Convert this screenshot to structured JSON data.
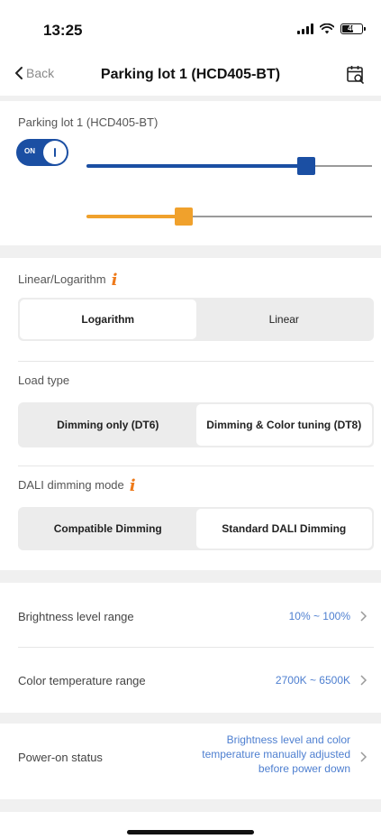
{
  "status_bar": {
    "time": "13:25",
    "battery": "40",
    "icons": [
      "signal-icon",
      "wifi-icon",
      "battery-icon"
    ]
  },
  "nav": {
    "back_label": "Back",
    "title": "Parking lot 1 (HCD405-BT)",
    "action_icon": "calendar-search-icon"
  },
  "device": {
    "name": "Parking lot 1 (HCD405-BT)",
    "power_toggle": {
      "label": "ON",
      "state": true
    },
    "brightness_level": 0.77,
    "color_temperature_level": 0.34,
    "colors": {
      "brightness": "#1b4fa3",
      "color_temperature": "#f0a12c",
      "track": "#9a9a9a"
    }
  },
  "linear_logarithm": {
    "label": "Linear/Logarithm",
    "options": [
      "Logarithm",
      "Linear"
    ],
    "selected": "Logarithm"
  },
  "load_type": {
    "label": "Load type",
    "options": [
      "Dimming only (DT6)",
      "Dimming & Color tuning (DT8)"
    ],
    "selected": "Dimming & Color tuning (DT8)"
  },
  "dali_mode": {
    "label": "DALI dimming mode",
    "options": [
      "Compatible Dimming",
      "Standard DALI Dimming"
    ],
    "selected": "Standard DALI Dimming"
  },
  "settings": {
    "brightness_range": {
      "label": "Brightness level range",
      "value": "10% ~ 100%"
    },
    "color_temp_range": {
      "label": "Color temperature range",
      "value": "2700K ~ 6500K"
    },
    "power_on_status": {
      "label": "Power-on status",
      "value": "Brightness level and color temperature manually adjusted before power down"
    }
  },
  "accent_colors": {
    "info_icon": "#ee7a1a",
    "value_text": "#4e7fd0"
  }
}
